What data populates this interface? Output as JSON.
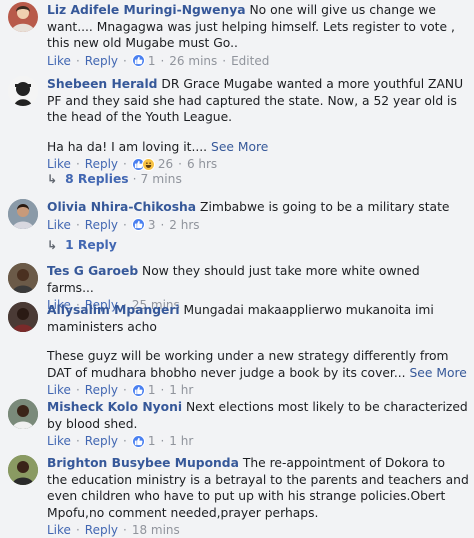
{
  "comments": [
    {
      "name": "Liz Adifele Muringi-Ngwenya",
      "text": "No one will give us change we want.... Mnagagwa was just helping himself. Lets register to vote , this new old Mugabe must Go..",
      "like": "Like",
      "reply": "Reply",
      "reaction_count": "1",
      "time": "26 mins",
      "edited": "Edited",
      "avatar_color": "#b85a4a"
    },
    {
      "name": "Shebeen Herald",
      "text": "DR Grace Mugabe wanted a more youthful ZANU PF and they said she had captured the state. Now, a 52 year old is the head of the Youth League.",
      "text2": "Ha ha da! I am loving it....",
      "see_more": "See More",
      "like": "Like",
      "reply": "Reply",
      "reaction_count": "26",
      "time": "6 hrs",
      "avatar_color": "#222222"
    },
    {
      "name": "Olivia Nhira-Chikosha",
      "text": "Zimbabwe is going to be a military state",
      "like": "Like",
      "reply": "Reply",
      "reaction_count": "3",
      "time": "2 hrs",
      "avatar_color": "#7a8a9a"
    },
    {
      "name": "Tes G Garoeb",
      "text": "Now they should just take more white owned farms...",
      "like": "Like",
      "reply": "Reply",
      "time": "25 mins",
      "avatar_color": "#5a4a3a"
    },
    {
      "name": "Allysalim Mpangeri",
      "text": "Mungadai makaapplierwo mukanoita imi maministers acho",
      "text2": "These guyz will be working under a new strategy differently from DAT of mudhara bhobho never judge a book by its cover...",
      "see_more": "See More",
      "like": "Like",
      "reply": "Reply",
      "reaction_count": "1",
      "time": "1 hr",
      "avatar_color": "#3a3030"
    },
    {
      "name": "Misheck Kolo Nyoni",
      "text": "Next elections most likely to be characterized by blood shed.",
      "like": "Like",
      "reply": "Reply",
      "reaction_count": "1",
      "time": "1 hr",
      "avatar_color": "#5a6b5a"
    },
    {
      "name": "Brighton Busybee Muponda",
      "text": "The re-appointment of Dokora to the education ministry is a betrayal to the parents and teachers and even children who have to put up with his strange policies.Obert Mpofu,no comment needed,prayer perhaps.",
      "like": "Like",
      "reply": "Reply",
      "time": "18 mins",
      "avatar_color": "#6b7b52"
    }
  ],
  "reply_threads": [
    {
      "label": "8 Replies",
      "time": "7 mins"
    },
    {
      "label": "1 Reply"
    }
  ],
  "colors": {
    "link": "#365899",
    "action": "#4267b2",
    "muted": "#90949c",
    "background": "#f2f3f5"
  }
}
